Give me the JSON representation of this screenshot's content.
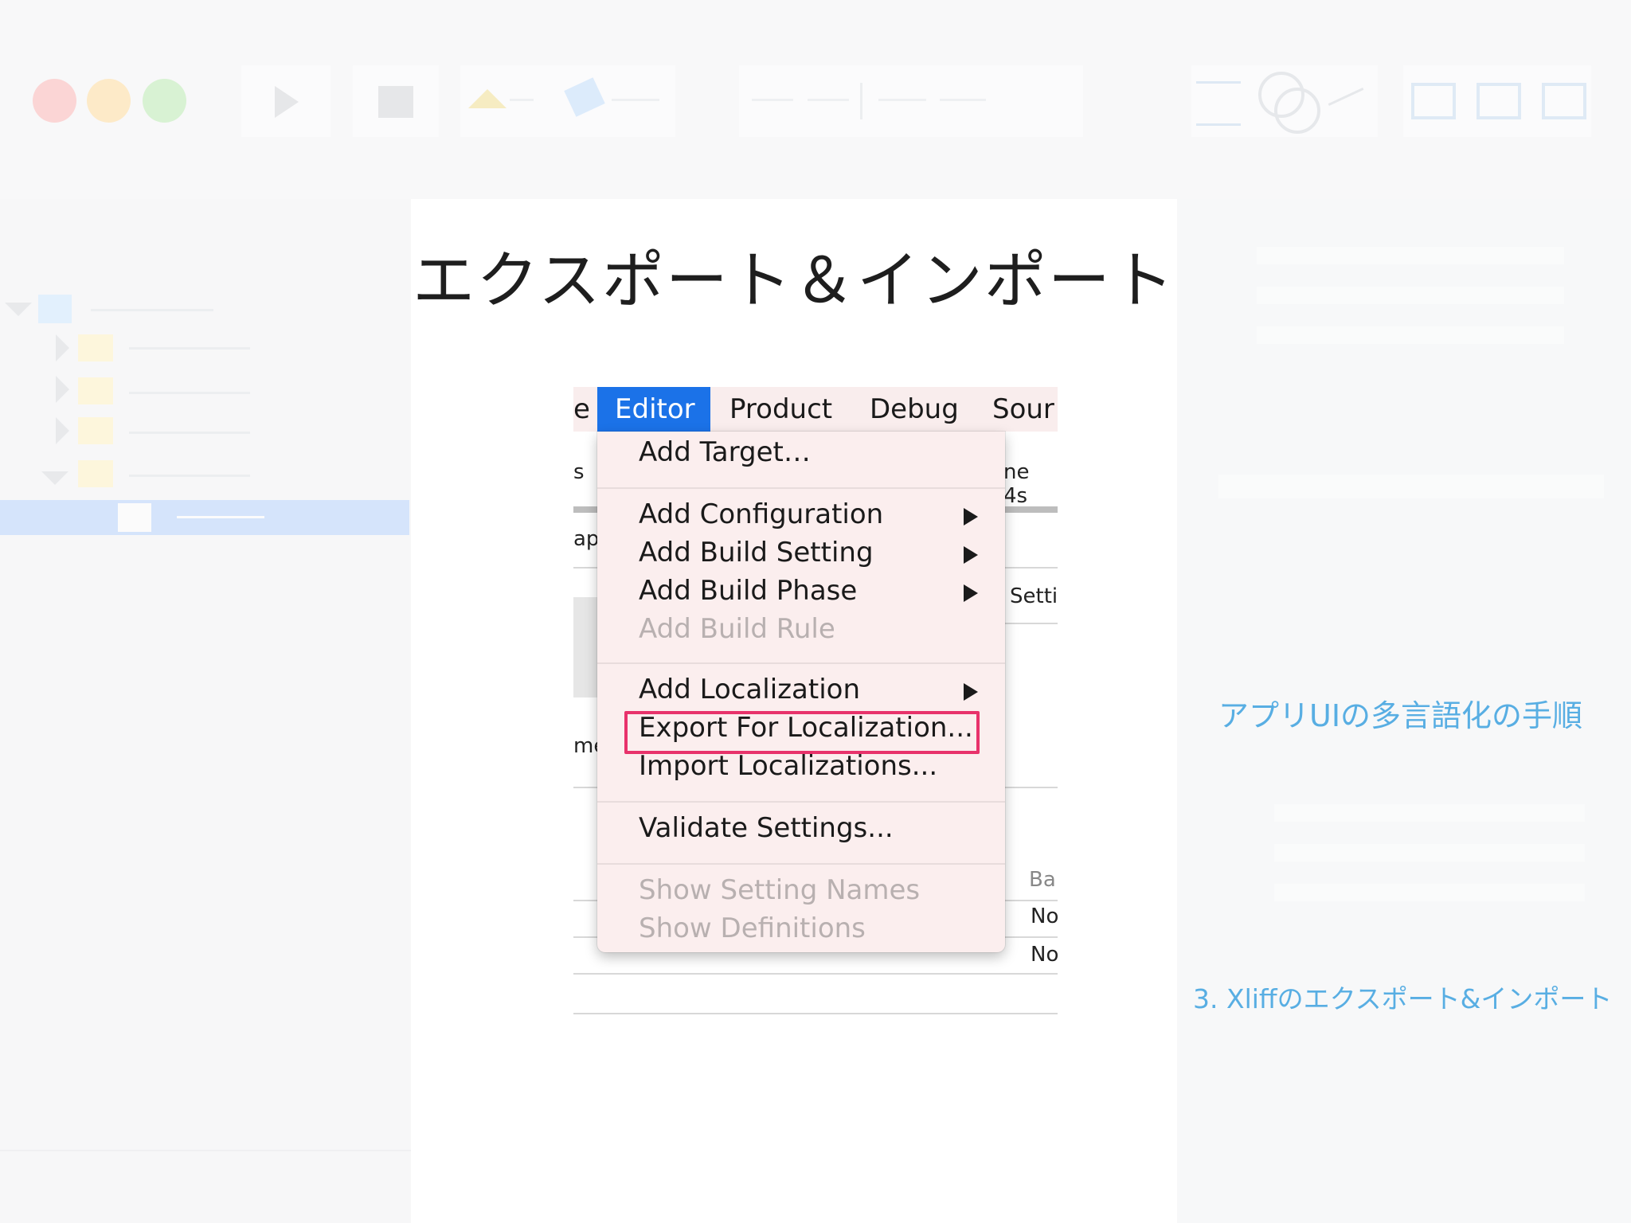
{
  "slide": {
    "title": "エクスポート＆インポート"
  },
  "inspector": {
    "section_link": "アプリUIの多言語化の手順",
    "step_link": "3. Xliffのエクスポート&インポート"
  },
  "screenshot": {
    "menubar": {
      "partial_left": "e",
      "items": [
        "Editor",
        "Product",
        "Debug",
        "Sour"
      ],
      "selected": "Editor"
    },
    "menu": {
      "items": [
        {
          "label": "Add Target…",
          "enabled": true,
          "submenu": false
        },
        {
          "label": "Add Configuration",
          "enabled": true,
          "submenu": true
        },
        {
          "label": "Add Build Setting",
          "enabled": true,
          "submenu": true
        },
        {
          "label": "Add Build Phase",
          "enabled": true,
          "submenu": true
        },
        {
          "label": "Add Build Rule",
          "enabled": false,
          "submenu": false
        },
        {
          "label": "Add Localization",
          "enabled": true,
          "submenu": true
        },
        {
          "label": "Export For Localization...",
          "enabled": true,
          "submenu": false
        },
        {
          "label": "Import Localizations...",
          "enabled": true,
          "submenu": false
        },
        {
          "label": "Validate Settings...",
          "enabled": true,
          "submenu": false
        },
        {
          "label": "Show Setting Names",
          "enabled": false,
          "submenu": false
        },
        {
          "label": "Show Definitions",
          "enabled": false,
          "submenu": false
        }
      ]
    },
    "background_fragments": {
      "left_1": "s",
      "left_2": "ap",
      "left_3": "me",
      "right_1": "ne 4s",
      "right_2": "Setti",
      "right_3": "Ba",
      "right_4": "No",
      "right_5": "No"
    }
  },
  "colors": {
    "menu_selection": "#1b72e8",
    "highlight_box": "#e8326b",
    "link": "#58aee3"
  }
}
